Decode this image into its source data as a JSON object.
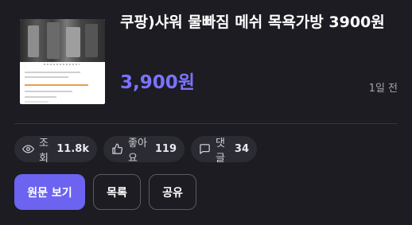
{
  "post": {
    "title": "쿠팡)샤워 물빠짐 메쉬 목욕가방 3900원",
    "price": "3,900원",
    "time_ago": "1일 전"
  },
  "stats": {
    "views_label": "조회",
    "views_count": "11.8k",
    "likes_label": "좋아요",
    "likes_count": "119",
    "comments_label": "댓글",
    "comments_count": "34"
  },
  "actions": {
    "view_original_label": "원문 보기",
    "list_label": "목록",
    "share_label": "공유"
  },
  "colors": {
    "accent": "#6c63f0",
    "price": "#7b73ff",
    "background": "#1c1c22"
  },
  "icons": [
    "eye-icon",
    "thumbs-up-icon",
    "comment-icon"
  ]
}
